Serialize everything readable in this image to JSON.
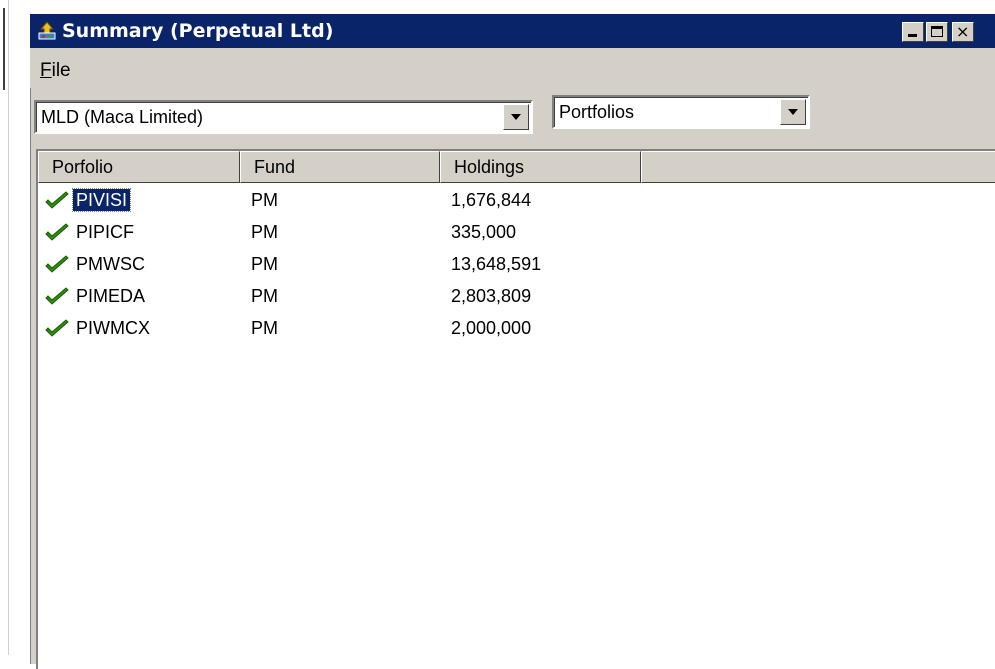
{
  "window": {
    "title": "Summary (Perpetual Ltd)",
    "close_glyph": "×"
  },
  "menu": {
    "file_label_underlined": "F",
    "file_label_rest": "ile"
  },
  "filters": {
    "company": "MLD (Maca Limited)",
    "view": "Portfolios"
  },
  "table": {
    "columns": [
      "Porfolio",
      "Fund",
      "Holdings",
      ""
    ],
    "rows": [
      {
        "portfolio": "PIVISI",
        "fund": "PM",
        "holdings": "1,676,844",
        "status_icon": "check-icon",
        "selected": true
      },
      {
        "portfolio": "PIPICF",
        "fund": "PM",
        "holdings": "335,000",
        "status_icon": "check-icon",
        "selected": false
      },
      {
        "portfolio": "PMWSC",
        "fund": "PM",
        "holdings": "13,648,591",
        "status_icon": "check-icon",
        "selected": false
      },
      {
        "portfolio": "PIMEDA",
        "fund": "PM",
        "holdings": "2,803,809",
        "status_icon": "check-icon",
        "selected": false
      },
      {
        "portfolio": "PIWMCX",
        "fund": "PM",
        "holdings": "2,000,000",
        "status_icon": "check-icon",
        "selected": false
      }
    ]
  },
  "colors": {
    "titlebar": "#0a246a",
    "face": "#d4d0c8",
    "check": "#2e8b0e",
    "selection": "#0a246a"
  }
}
